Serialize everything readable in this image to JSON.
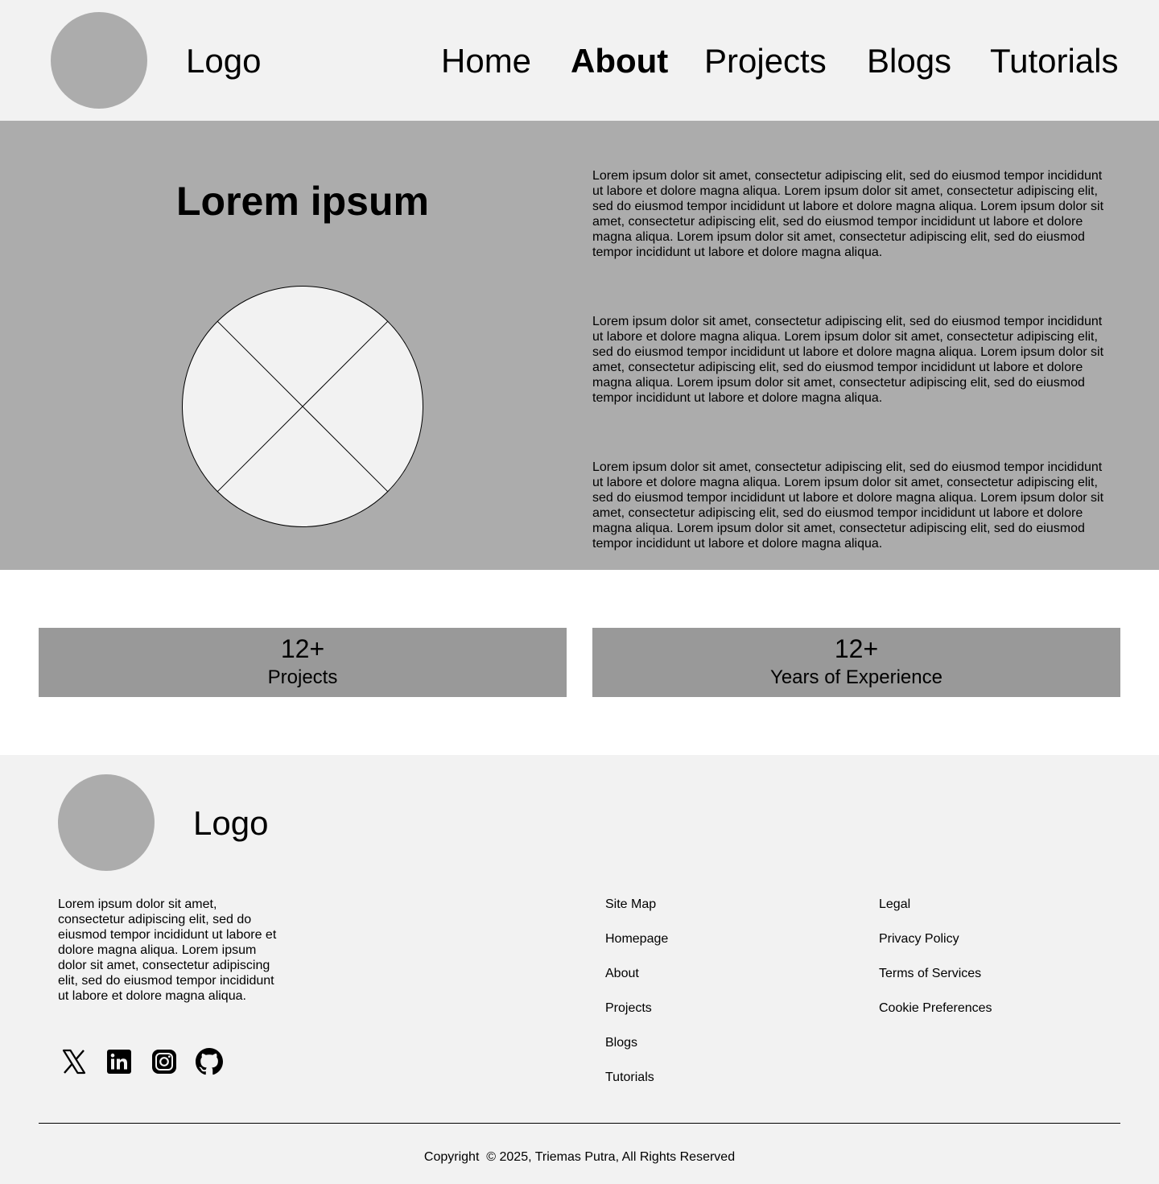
{
  "header": {
    "logo_text": "Logo",
    "nav": [
      {
        "label": "Home",
        "active": false
      },
      {
        "label": "About",
        "active": true
      },
      {
        "label": "Projects",
        "active": false
      },
      {
        "label": "Blogs",
        "active": false
      },
      {
        "label": "Tutorials",
        "active": false
      }
    ]
  },
  "hero": {
    "title": "Lorem ipsum",
    "paragraphs": [
      "Lorem ipsum dolor sit amet, consectetur adipiscing elit, sed do eiusmod tempor incididunt ut labore et dolore magna aliqua. Lorem ipsum dolor sit amet, consectetur adipiscing elit, sed do eiusmod tempor incididunt ut labore et dolore magna aliqua. Lorem ipsum dolor sit amet, consectetur adipiscing elit, sed do eiusmod tempor incididunt ut labore et dolore magna aliqua. Lorem ipsum dolor sit amet, consectetur adipiscing elit, sed do eiusmod tempor incididunt ut labore et dolore magna aliqua.",
      "Lorem ipsum dolor sit amet, consectetur adipiscing elit, sed do eiusmod tempor incididunt ut labore et dolore magna aliqua. Lorem ipsum dolor sit amet, consectetur adipiscing elit, sed do eiusmod tempor incididunt ut labore et dolore magna aliqua. Lorem ipsum dolor sit amet, consectetur adipiscing elit, sed do eiusmod tempor incididunt ut labore et dolore magna aliqua. Lorem ipsum dolor sit amet, consectetur adipiscing elit, sed do eiusmod tempor incididunt ut labore et dolore magna aliqua.",
      "Lorem ipsum dolor sit amet, consectetur adipiscing elit, sed do eiusmod tempor incididunt ut labore et dolore magna aliqua. Lorem ipsum dolor sit amet, consectetur adipiscing elit, sed do eiusmod tempor incididunt ut labore et dolore magna aliqua. Lorem ipsum dolor sit amet, consectetur adipiscing elit, sed do eiusmod tempor incididunt ut labore et dolore magna aliqua. Lorem ipsum dolor sit amet, consectetur adipiscing elit, sed do eiusmod tempor incididunt ut labore et dolore magna aliqua."
    ]
  },
  "stats": [
    {
      "number": "12+",
      "label": "Projects"
    },
    {
      "number": "12+",
      "label": "Years of Experience"
    }
  ],
  "footer": {
    "logo_text": "Logo",
    "description": "Lorem ipsum dolor sit amet, consectetur adipiscing elit, sed do eiusmod tempor incididunt ut labore et dolore magna aliqua. Lorem ipsum dolor sit amet, consectetur adipiscing elit, sed do eiusmod tempor incididunt ut labore et dolore magna aliqua.",
    "social_icons": [
      "x-icon",
      "linkedin-icon",
      "instagram-icon",
      "github-icon"
    ],
    "sitemap": {
      "heading": "Site Map",
      "links": [
        "Homepage",
        "About",
        "Projects",
        "Blogs",
        "Tutorials"
      ]
    },
    "legal": {
      "heading": "Legal",
      "links": [
        "Privacy Policy",
        "Terms of Services",
        "Cookie Preferences"
      ]
    },
    "copyright": "Copyright  © 2025, Triemas Putra, All Rights Reserved"
  },
  "colors": {
    "header_bg": "#f2f2f2",
    "hero_bg": "#acacac",
    "stat_bg": "#999999",
    "logo_placeholder": "#acacac"
  }
}
